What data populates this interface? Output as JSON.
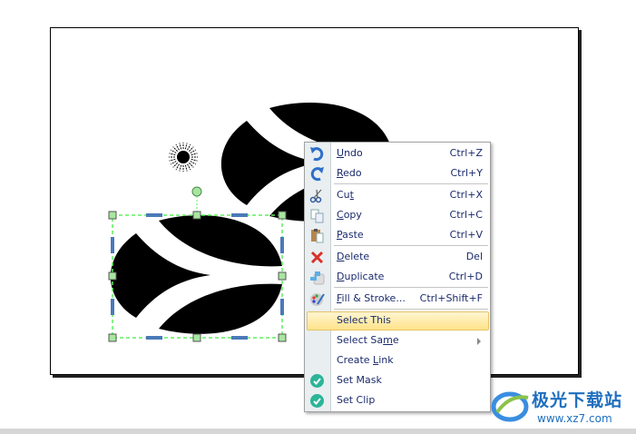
{
  "menu": {
    "items": [
      {
        "icon": "undo-icon",
        "pre": "",
        "key": "U",
        "post": "ndo",
        "shortcut": "Ctrl+Z"
      },
      {
        "icon": "redo-icon",
        "pre": "",
        "key": "R",
        "post": "edo",
        "shortcut": "Ctrl+Y"
      },
      {
        "sep": true
      },
      {
        "icon": "cut-icon",
        "pre": "Cu",
        "key": "t",
        "post": "",
        "shortcut": "Ctrl+X"
      },
      {
        "icon": "copy-icon",
        "pre": "",
        "key": "C",
        "post": "opy",
        "shortcut": "Ctrl+C"
      },
      {
        "icon": "paste-icon",
        "pre": "",
        "key": "P",
        "post": "aste",
        "shortcut": "Ctrl+V"
      },
      {
        "sep": true
      },
      {
        "icon": "delete-icon",
        "pre": "",
        "key": "D",
        "post": "elete",
        "shortcut": "Del"
      },
      {
        "icon": "duplicate-icon",
        "pre": "",
        "key": "D",
        "post": "uplicate",
        "shortcut": "Ctrl+D"
      },
      {
        "sep": true
      },
      {
        "icon": "fill-stroke-icon",
        "pre": "",
        "key": "F",
        "post": "ill & Stroke...",
        "shortcut": "Ctrl+Shift+F"
      },
      {
        "sep": true
      },
      {
        "icon": "",
        "pre": "Select This",
        "key": "",
        "post": "",
        "shortcut": "",
        "highlighted": true
      },
      {
        "icon": "",
        "pre": "Select Sa",
        "key": "m",
        "post": "e",
        "shortcut": "",
        "submenu": true
      },
      {
        "icon": "",
        "pre": "Create ",
        "key": "L",
        "post": "ink",
        "shortcut": ""
      },
      {
        "icon": "check-icon",
        "pre": "Set Mask",
        "key": "",
        "post": "",
        "shortcut": ""
      },
      {
        "icon": "check-icon",
        "pre": "Set Clip",
        "key": "",
        "post": "",
        "shortcut": ""
      }
    ]
  },
  "watermark": {
    "title": "极光下载站",
    "url": "www.xz7.com"
  },
  "colors": {
    "selection": "#5ef05e",
    "handle": "#a8e6a0",
    "scale_handle": "#4a7ab8",
    "highlight": "#ffe38a"
  }
}
